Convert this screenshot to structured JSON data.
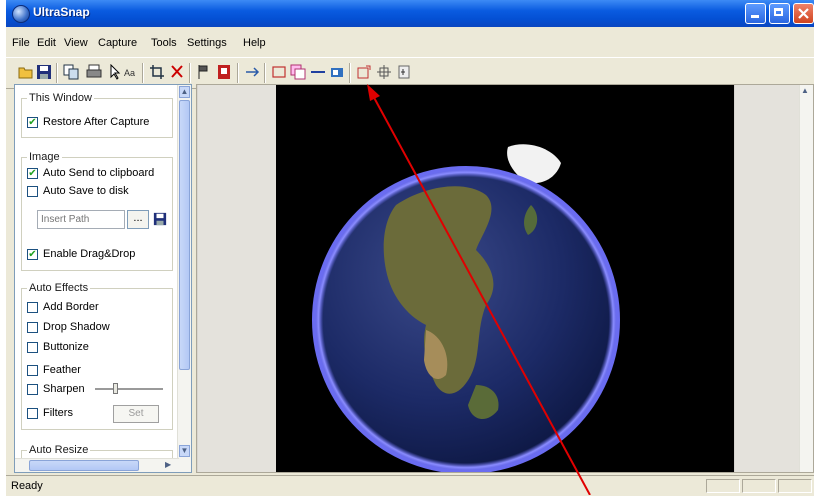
{
  "window": {
    "title": "UltraSnap"
  },
  "menu": {
    "items": [
      "File",
      "Edit",
      "View",
      "Capture",
      "Tools",
      "Settings",
      "Help"
    ]
  },
  "toolbar": {
    "tools": [
      "open-folder-icon",
      "save-icon",
      "copy-icon",
      "print-icon",
      "pointer-icon",
      "text-select-icon",
      "crop-icon",
      "cut-icon",
      "flag-icon",
      "pdf-icon",
      "move-icon",
      "capture-rectangle-icon",
      "capture-window-icon",
      "capture-line-icon",
      "capture-scroll-icon",
      "capture-region-icon",
      "crosshair-icon",
      "hand-icon"
    ]
  },
  "sidebar": {
    "this_window": {
      "title": "This Window",
      "restore_after_capture": {
        "label": "Restore After Capture",
        "checked": true
      }
    },
    "image": {
      "title": "Image",
      "auto_send_clipboard": {
        "label": "Auto Send to clipboard",
        "checked": true
      },
      "auto_save_disk": {
        "label": "Auto Save to disk",
        "checked": false
      },
      "path_placeholder": "Insert Path",
      "browse_label": "...",
      "enable_drag_drop": {
        "label": "Enable Drag&Drop",
        "checked": true
      }
    },
    "auto_effects": {
      "title": "Auto Effects",
      "add_border": {
        "label": "Add Border",
        "checked": false
      },
      "drop_shadow": {
        "label": "Drop Shadow",
        "checked": false
      },
      "buttonize": {
        "label": "Buttonize",
        "checked": false
      },
      "feather": {
        "label": "Feather",
        "checked": false
      },
      "sharpen": {
        "label": "Sharpen",
        "checked": false
      },
      "filters": {
        "label": "Filters",
        "checked": false
      },
      "set_label": "Set"
    },
    "auto_resize": {
      "title": "Auto Resize"
    }
  },
  "status": {
    "text": "Ready"
  },
  "colors": {
    "titlebar": "#0a5be0",
    "annotation_arrow": "#e00000",
    "globe_ring": "#6a6cf0"
  }
}
